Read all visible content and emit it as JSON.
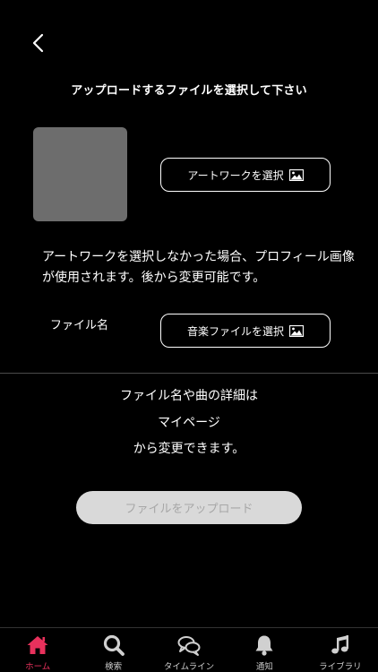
{
  "page": {
    "title": "アップロードするファイルを選択して下さい"
  },
  "artwork": {
    "select_label": "アートワークを選択",
    "note": "アートワークを選択しなかった場合、プロフィール画像が使用されます。後から変更可能です。"
  },
  "music": {
    "field_label": "ファイル名",
    "select_label": "音楽ファイルを選択"
  },
  "info_lines": [
    "ファイル名や曲の詳細は",
    "マイページ",
    "から変更できます。"
  ],
  "upload": {
    "label": "ファイルをアップロード"
  },
  "tabbar": {
    "items": [
      {
        "label": "ホーム",
        "icon": "home-icon"
      },
      {
        "label": "検索",
        "icon": "search-icon"
      },
      {
        "label": "タイムライン",
        "icon": "chat-bubbles-icon"
      },
      {
        "label": "通知",
        "icon": "bell-icon"
      },
      {
        "label": "ライブラリ",
        "icon": "music-note-icon"
      }
    ],
    "active_index": 0
  },
  "colors": {
    "background": "#000000",
    "accent": "#e8315c",
    "disabled_button": "#d9d9d9",
    "placeholder": "#6d6d6d"
  }
}
